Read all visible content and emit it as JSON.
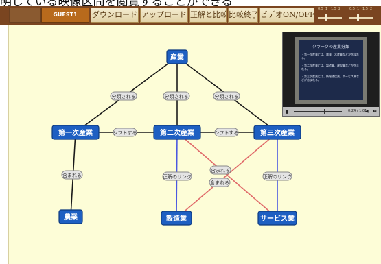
{
  "headline": "明している映像区間を閲覧することができる",
  "toolbar": {
    "disabled_label": "",
    "guest_label": "GUEST1",
    "download_label": "ダウンロード",
    "upload_label": "アップロード",
    "compare_label": "正解と比較",
    "end_compare_label": "比較終了",
    "video_toggle_label": "ビデオON/OFF",
    "slider_ticks": [
      "0.5",
      "1",
      "1.5",
      "2",
      "0.5",
      "1",
      "1.5",
      "2"
    ]
  },
  "nodes": {
    "sangyo": "産業",
    "primary": "第一次産業",
    "secondary": "第二次産業",
    "tertiary": "第三次産業",
    "agriculture": "農業",
    "manufacturing": "製造業",
    "service": "サービス業"
  },
  "links": {
    "classified": "分類される",
    "shift": "シフトする",
    "included": "含まれる",
    "answer_link": "正解のリンク"
  },
  "colors": {
    "node_fill": "#1e5fc2",
    "black_link": "#1a1a1a",
    "blue_link": "#4b58e0",
    "red_link": "#e06a6a",
    "canvas": "#fdfdd7",
    "toolbar": "#7a4520"
  },
  "video": {
    "slide_title": "クラークの産業分類",
    "bullets": [
      "・第一次産業には、農業、水産業などが含まれる。",
      "・第二次産業には、製造業、建設業などが含まれる。",
      "・第三次産業には、情報通信業、サービス業などが含まれる。"
    ],
    "time": "0:24 / 1:01",
    "play_icon": "play-icon",
    "volume_icon": "volume-icon",
    "fullscreen_icon": "fullscreen-icon",
    "progress_fraction": 0.64
  }
}
